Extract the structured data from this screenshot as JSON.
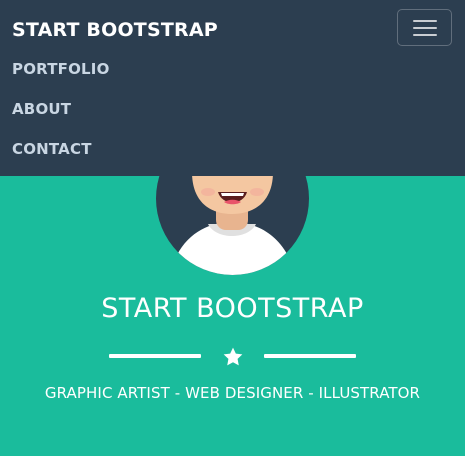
{
  "navbar": {
    "brand": "START BOOTSTRAP",
    "toggle_icon": "hamburger-menu-icon",
    "links": [
      {
        "label": "PORTFOLIO"
      },
      {
        "label": "ABOUT"
      },
      {
        "label": "CONTACT"
      }
    ],
    "background": "#2c3e50",
    "link_color": "#c9d6e3"
  },
  "masthead": {
    "avatar_icon": "avatar-illustration",
    "title": "START BOOTSTRAP",
    "divider_icon": "star-icon",
    "subtitle": "GRAPHIC ARTIST - WEB DESIGNER - ILLUSTRATOR",
    "background": "#1abc9c"
  }
}
